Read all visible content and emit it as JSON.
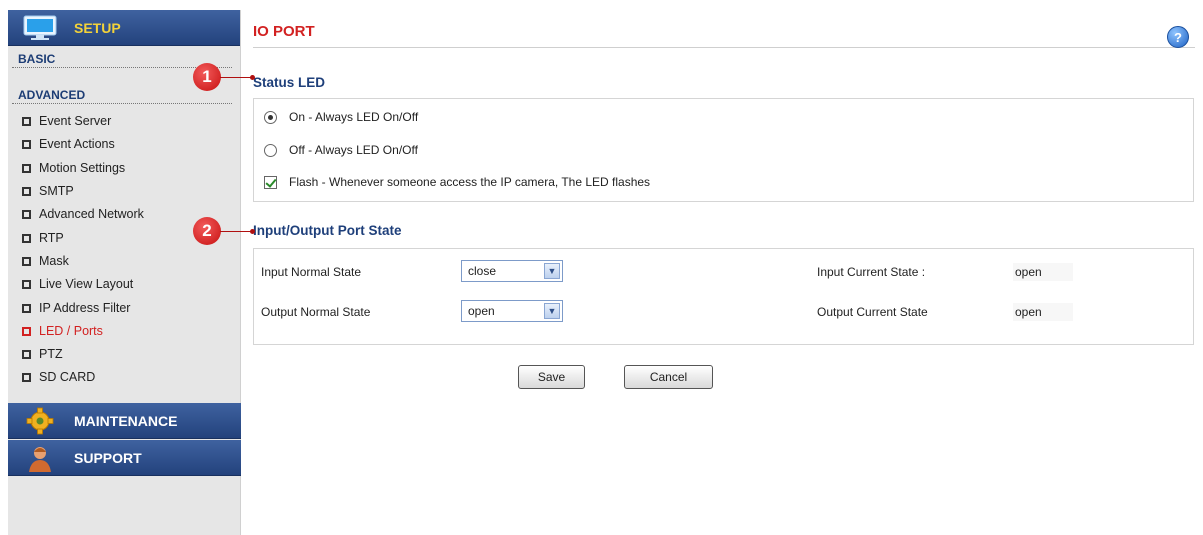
{
  "sidebar": {
    "setup_label": "SETUP",
    "basic_label": "BASIC",
    "advanced_label": "ADVANCED",
    "items": [
      {
        "label": "Event Server"
      },
      {
        "label": "Event Actions"
      },
      {
        "label": "Motion Settings"
      },
      {
        "label": "SMTP"
      },
      {
        "label": "Advanced Network"
      },
      {
        "label": "RTP"
      },
      {
        "label": "Mask"
      },
      {
        "label": "Live View Layout"
      },
      {
        "label": "IP Address Filter"
      },
      {
        "label": "LED / Ports"
      },
      {
        "label": "PTZ"
      },
      {
        "label": "SD CARD"
      }
    ],
    "active_item": "LED / Ports",
    "maintenance_label": "MAINTENANCE",
    "support_label": "SUPPORT"
  },
  "main": {
    "title": "IO PORT",
    "help_glyph": "?",
    "status_led": {
      "heading": "Status LED",
      "options": [
        {
          "label": "On - Always LED On/Off",
          "checked": true
        },
        {
          "label": "Off - Always LED On/Off",
          "checked": false
        }
      ],
      "flash": {
        "label": "Flash - Whenever someone access the IP camera, The LED flashes",
        "checked": true
      }
    },
    "io_state": {
      "heading": "Input/Output Port State",
      "input_normal_label": "Input Normal State",
      "input_normal_value": "close",
      "output_normal_label": "Output Normal State",
      "output_normal_value": "open",
      "input_current_label": "Input Current State :",
      "input_current_value": "open",
      "output_current_label": "Output Current State",
      "output_current_value": "open"
    },
    "buttons": {
      "save": "Save",
      "cancel": "Cancel"
    }
  },
  "callouts": {
    "one": "1",
    "two": "2"
  },
  "colors": {
    "accent_red": "#d22121",
    "nav_blue": "#23427c",
    "setup_yellow": "#f2d23a"
  }
}
